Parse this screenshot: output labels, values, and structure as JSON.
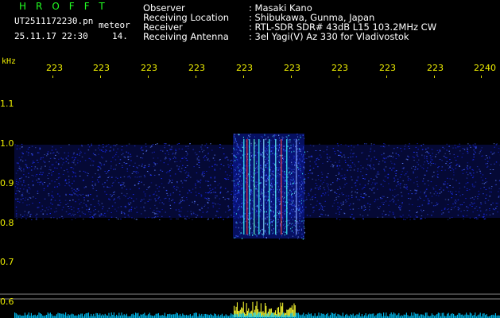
{
  "header": {
    "station": "HROFFT",
    "filename": "UT2511172230.pn",
    "mode": "meteor",
    "datetime": "25.11.17 22:30",
    "number": "14."
  },
  "info": [
    {
      "label": "Observer",
      "value": ": Masaki Kano"
    },
    {
      "label": "Receiving Location",
      "value": ": Shibukawa, Gunma, Japan"
    },
    {
      "label": "Receiver",
      "value": ": RTL-SDR SDR# 43dB L15 103.2MHz CW"
    },
    {
      "label": "Receiving Antenna",
      "value": ": 3el Yagi(V) Az 330 for Vladivostok"
    }
  ],
  "x_axis": {
    "ticks": [
      "223",
      "223",
      "223",
      "223",
      "223",
      "223",
      "223",
      "223",
      "223",
      "2240"
    ]
  },
  "y_axis": {
    "unit": "kHz",
    "ticks": [
      "1.1",
      "1.0",
      "0.9",
      "0.8",
      "0.7",
      "0.6"
    ]
  },
  "colors": {
    "background": "#000000",
    "noise": "#1a2aff",
    "echo": "#44ffff",
    "hot": "#ff3333",
    "bars": "#ffff33",
    "baseline": "#00c8ff",
    "axis_text": "#f0f000",
    "ref_lines": "#888888"
  }
}
